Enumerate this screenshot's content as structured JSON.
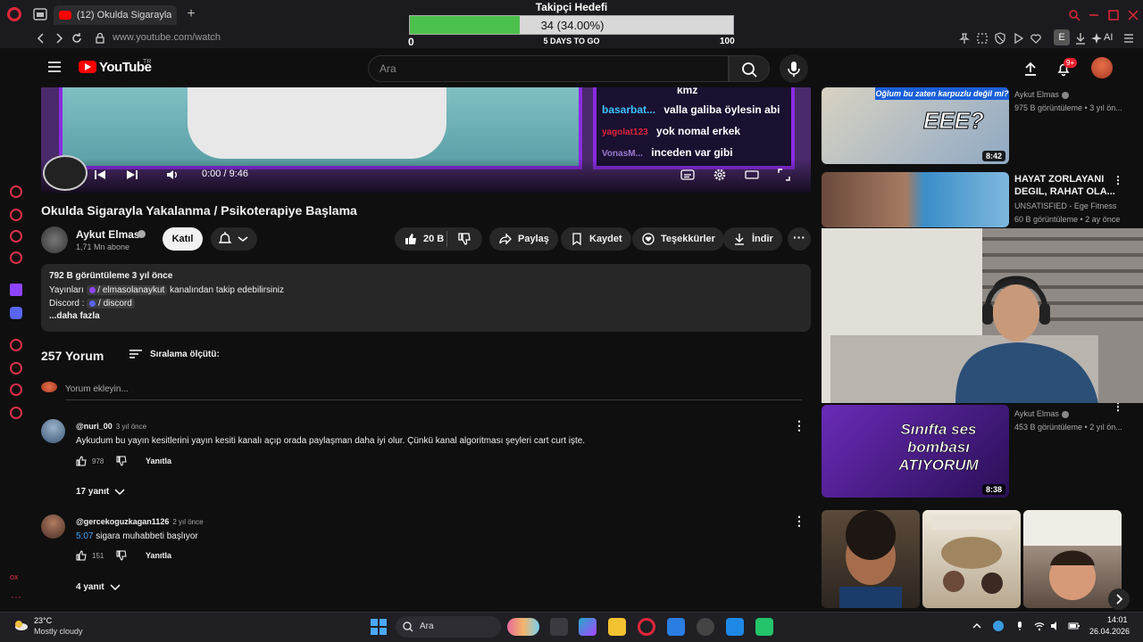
{
  "colors": {
    "accent": "#ff0000",
    "background": "#0f0f0f",
    "goal_fill": "#4cc04c",
    "overlay_purple": "#8a2be2",
    "opera_red": "#e0263a",
    "link_blue": "#3ea6ff"
  },
  "browser": {
    "tab_title": "(12) Okulda Sigarayla Yakalanma / Psikoterapiye Başlama",
    "url": "www.youtube.com/watch",
    "ai_label": "AI",
    "extension_letter": "E"
  },
  "goal_overlay": {
    "title": "Takipçi Hedefi",
    "value_text": "34 (34.00%)",
    "progress": 0.34,
    "min": "0",
    "max": "100",
    "days_left": "5 DAYS TO GO"
  },
  "opera_sidebar": {
    "ox_label": "ox",
    "more_label": "···"
  },
  "header": {
    "logo_text": "YouTube",
    "country_code": "TR",
    "search_placeholder": "Ara",
    "notification_count": "9+"
  },
  "player": {
    "time": "0:00 / 9:46",
    "chat": [
      {
        "user": "",
        "text": "kmz"
      },
      {
        "user": "basarbat...",
        "text": "valla galiba öylesin abi"
      },
      {
        "user": "yagolat123",
        "text": "yok nomal erkek"
      },
      {
        "user": "VonasM...",
        "text": "inceden var gibi"
      }
    ]
  },
  "video": {
    "title": "Okulda Sigarayla Yakalanma / Psikoterapiye Başlama",
    "channel": "Aykut Elmas",
    "subscribers": "1,71 Mn abone",
    "join_label": "Katıl",
    "likes": "20 B",
    "share_label": "Paylaş",
    "save_label": "Kaydet",
    "thanks_label": "Teşekkürler",
    "download_label": "İndir"
  },
  "description": {
    "stats": "792 B görüntüleme  3 yıl önce",
    "line1_prefix": "Yayınları",
    "line1_chip": "/ elmasolanaykut",
    "line1_suffix": "kanalından takip edebilirsiniz",
    "line2_prefix": "Discord :",
    "line2_chip": "/ discord",
    "more": "...daha fazla"
  },
  "comments_section": {
    "count": "257 Yorum",
    "sort_label": "Sıralama ölçütü:",
    "add_placeholder": "Yorum ekleyin...",
    "reply_label": "Yanıtla",
    "comments": [
      {
        "author": "@nuri_00",
        "date": "3 yıl önce",
        "timestamp": "",
        "text": "Aykudum bu yayın kesitlerini yayın kesiti kanalı açıp orada paylaşman daha iyi olur. Çünkü kanal algoritması şeyleri cart curt işte.",
        "likes": "978",
        "replies": "17 yanıt"
      },
      {
        "author": "@gercekoguzkagan1126",
        "date": "2 yıl önce",
        "timestamp": "5:07",
        "text": "sigara muhabbeti başlıyor",
        "likes": "151",
        "replies": "4 yanıt"
      }
    ]
  },
  "recommendations": [
    {
      "thumb_text": "EEE?",
      "thumb_caption": "Oğlum bu zaten karpuzlu değil mi?",
      "duration": "8:42",
      "title": "",
      "channel": "Aykut Elmas",
      "meta": "975 B görüntüleme • 3 yıl ön..."
    },
    {
      "thumb_text": "",
      "thumb_caption": "",
      "duration": "",
      "title": "HAYAT ZORLAYANI DEGIL, RAHAT OLA...",
      "channel": "UNSATISFIED - Ege Fitness",
      "meta": "60 B görüntüleme • 2 ay önce"
    },
    {
      "thumb_text": "Sınıfta ses bombası ATIYORUM",
      "thumb_caption": "",
      "duration": "8:38",
      "title": "",
      "channel": "Aykut Elmas",
      "meta": "453 B görüntüleme • 2 yıl ön..."
    }
  ],
  "taskbar": {
    "temperature": "23°C",
    "weather": "Mostly cloudy",
    "search_placeholder": "Ara",
    "time": "14:01",
    "date": "26.04.2026"
  }
}
